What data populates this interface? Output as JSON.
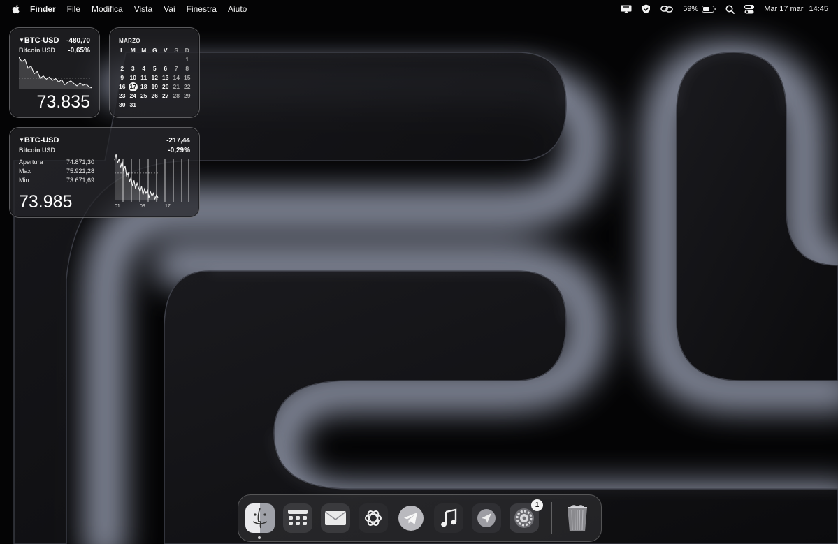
{
  "menubar": {
    "app_name": "Finder",
    "menus": [
      "File",
      "Modifica",
      "Vista",
      "Vai",
      "Finestra",
      "Aiuto"
    ],
    "battery_percent": "59%",
    "date": "Mar 17 mar",
    "time": "14:45"
  },
  "stock_small": {
    "ticker": "BTC-USD",
    "name": "Bitcoin USD",
    "change": "-480,70",
    "change_pct": "-0,65%",
    "price": "73.835",
    "trend": "down",
    "series": [
      100,
      92,
      96,
      80,
      84,
      70,
      74,
      62,
      66,
      60,
      64,
      58,
      61,
      55,
      59,
      50,
      54,
      57,
      52,
      48,
      53,
      49,
      51,
      46,
      44
    ],
    "baseline": 62
  },
  "calendar": {
    "month": "MARZO",
    "weekdays": [
      "L",
      "M",
      "M",
      "G",
      "V",
      "S",
      "D"
    ],
    "weeks": [
      [
        "",
        "",
        "",
        "",
        "",
        "",
        "1"
      ],
      [
        "2",
        "3",
        "4",
        "5",
        "6",
        "7",
        "8"
      ],
      [
        "9",
        "10",
        "11",
        "12",
        "13",
        "14",
        "15"
      ],
      [
        "16",
        "17",
        "18",
        "19",
        "20",
        "21",
        "22"
      ],
      [
        "23",
        "24",
        "25",
        "26",
        "27",
        "28",
        "29"
      ],
      [
        "30",
        "31",
        "",
        "",
        "",
        "",
        ""
      ]
    ],
    "today": "17"
  },
  "stock_wide": {
    "ticker": "BTC-USD",
    "name": "Bitcoin USD",
    "change": "-217,44",
    "change_pct": "-0,29%",
    "price": "73.985",
    "trend": "down",
    "open_label": "Apertura",
    "open_value": "74.871,30",
    "max_label": "Max",
    "max_value": "75.921,28",
    "min_label": "Min",
    "min_value": "73.671,69",
    "x_ticks": [
      "01",
      "09",
      "17"
    ],
    "series": [
      88,
      96,
      84,
      90,
      78,
      86,
      74,
      80,
      66,
      70,
      58,
      64,
      52,
      60,
      48,
      56,
      50,
      44,
      52,
      40,
      48,
      42,
      46,
      36,
      44,
      38,
      42,
      34,
      40,
      36
    ],
    "baseline": 70
  },
  "dock": {
    "items": [
      {
        "name": "finder",
        "icon": "finder-icon",
        "running": true
      },
      {
        "name": "launchpad",
        "icon": "launchpad-icon"
      },
      {
        "name": "mail",
        "icon": "mail-icon"
      },
      {
        "name": "chatgpt",
        "icon": "chatgpt-icon"
      },
      {
        "name": "telegram",
        "icon": "telegram-icon"
      },
      {
        "name": "music",
        "icon": "music-icon"
      },
      {
        "name": "copilot",
        "icon": "copilot-icon"
      },
      {
        "name": "system-settings",
        "icon": "settings-icon",
        "badge": "1"
      },
      {
        "name": "trash",
        "icon": "trash-icon"
      }
    ]
  }
}
